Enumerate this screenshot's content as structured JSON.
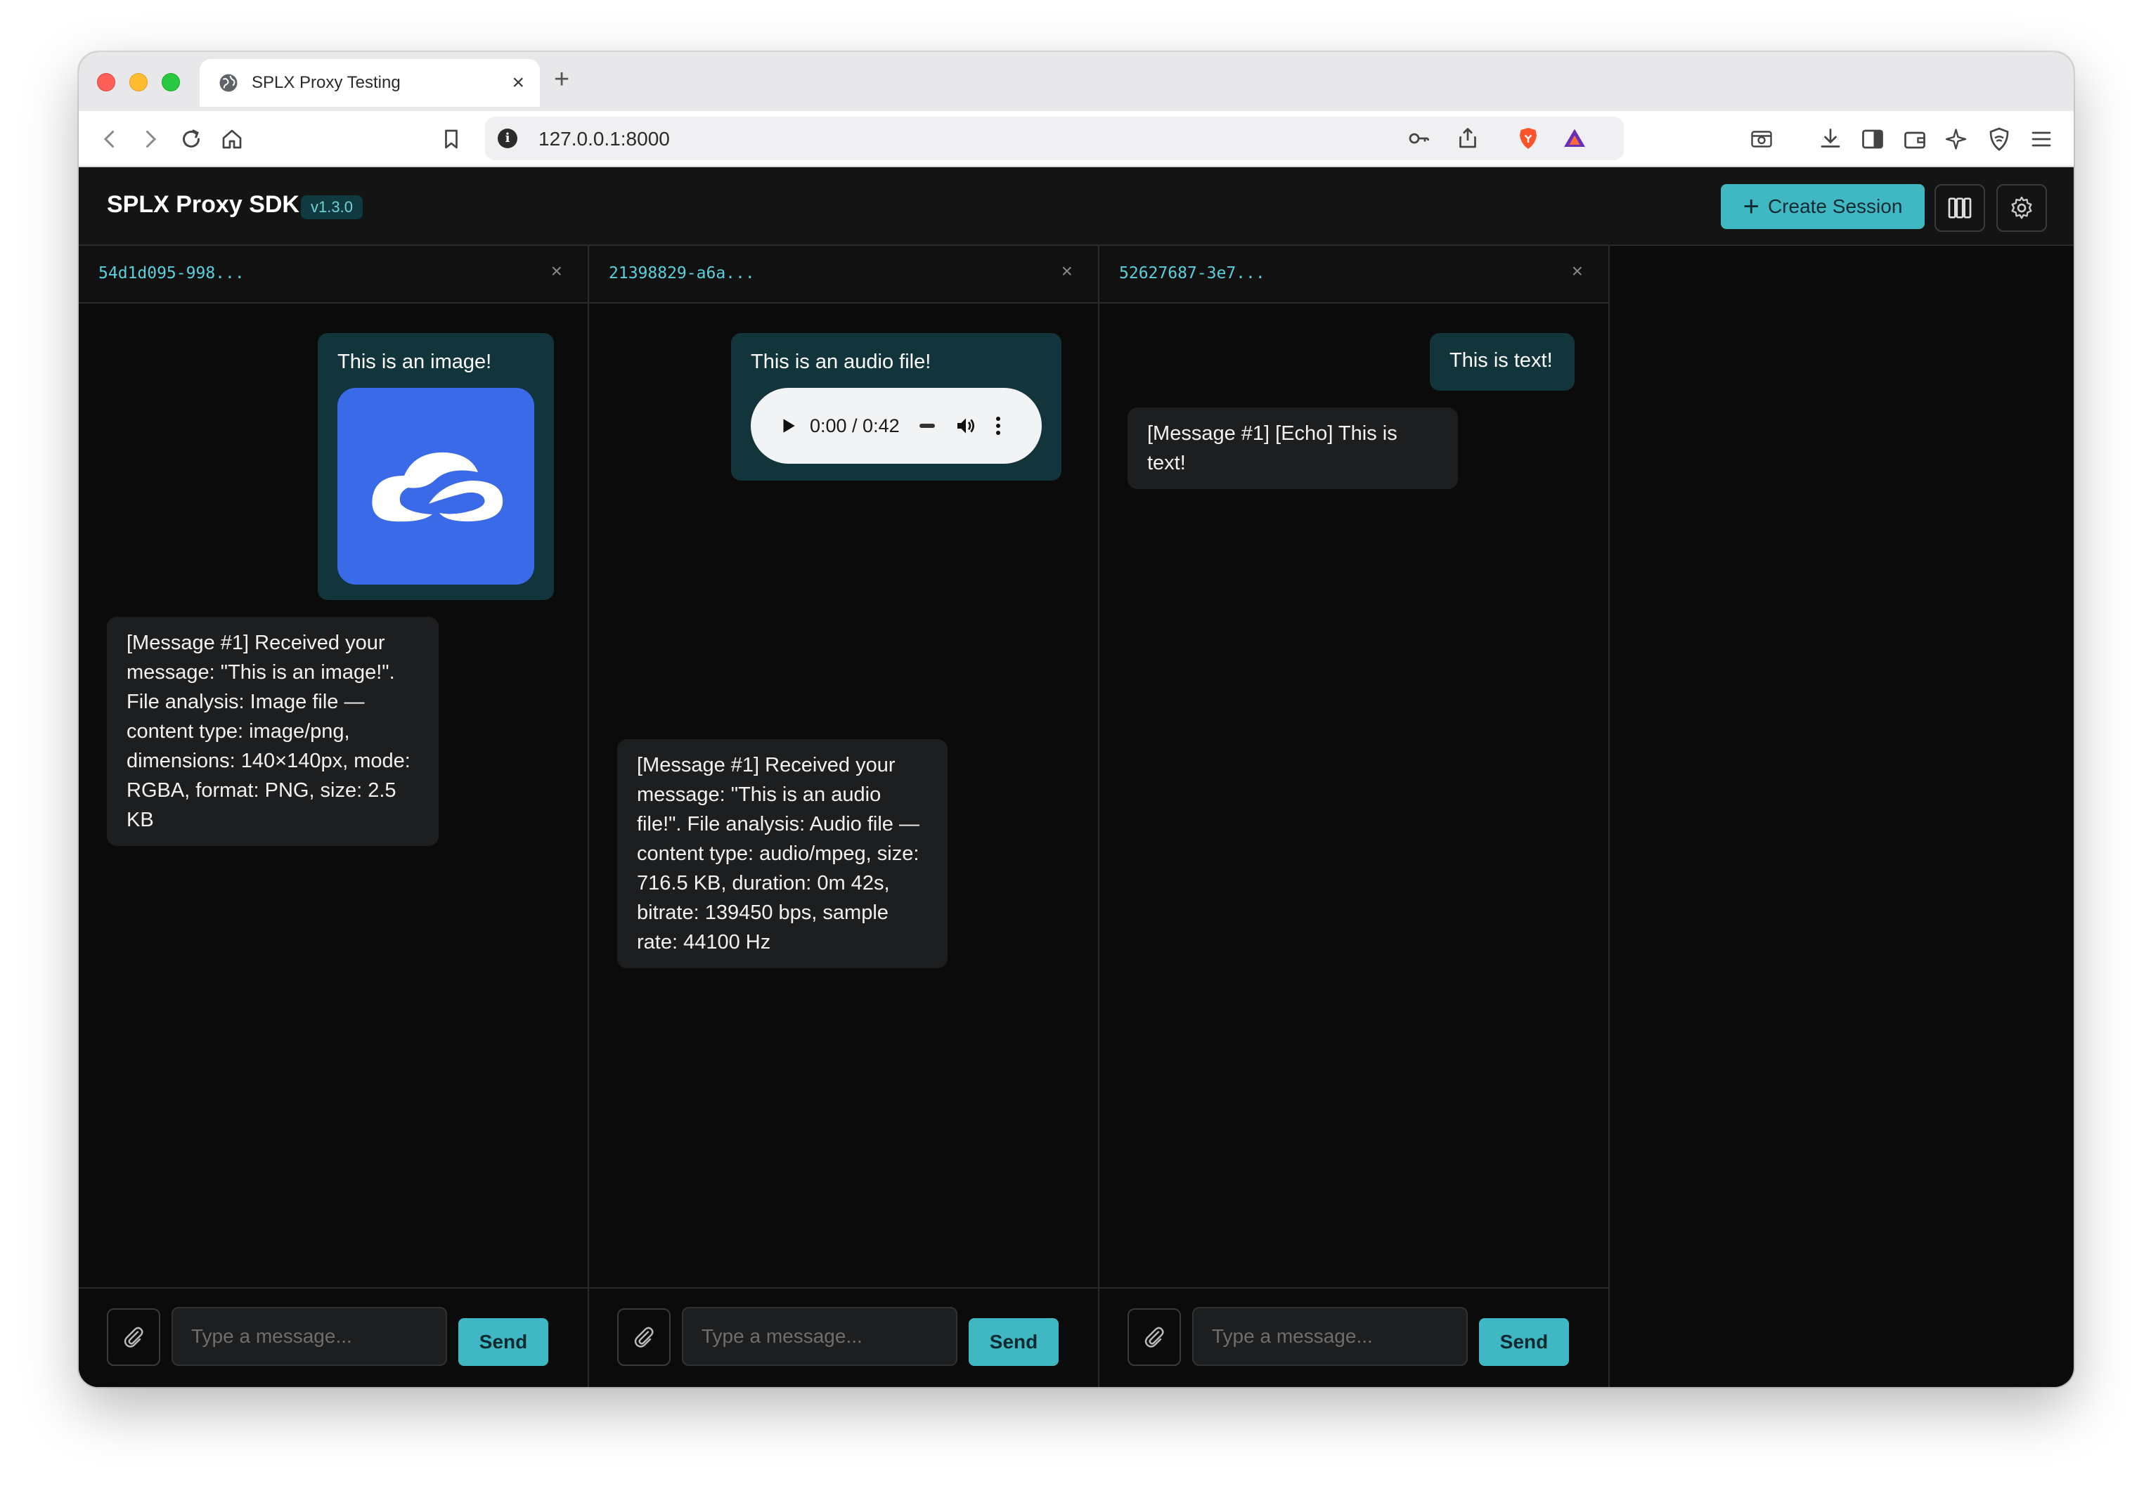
{
  "browser": {
    "tab_title": "SPLX Proxy Testing",
    "tab_close": "×",
    "new_tab": "+",
    "url": "127.0.0.1:8000",
    "url_info_icon": "i"
  },
  "app": {
    "title": "SPLX Proxy SDK",
    "version": "v1.3.0",
    "create_session_label": "Create Session",
    "create_session_plus": "+"
  },
  "panels": [
    {
      "session_id": "54d1d095-998...",
      "close": "×",
      "user_message": "This is an image!",
      "bot_reply": "[Message #1] Received your message: \"This is an image!\". File analysis: Image file — content type: image/png, dimensions: 140×140px, mode: RGBA, format: PNG, size: 2.5 KB",
      "composer": {
        "placeholder": "Type a message...",
        "send_label": "Send"
      }
    },
    {
      "session_id": "21398829-a6a...",
      "close": "×",
      "user_message": "This is an audio file!",
      "audio": {
        "time": "0:00 / 0:42"
      },
      "bot_reply": "[Message #1] Received your message: \"This is an audio file!\". File analysis: Audio file — content type: audio/mpeg, size: 716.5 KB, duration: 0m 42s, bitrate: 139450 bps, sample rate: 44100 Hz",
      "composer": {
        "placeholder": "Type a message...",
        "send_label": "Send"
      }
    },
    {
      "session_id": "52627687-3e7...",
      "close": "×",
      "user_message": "This is text!",
      "bot_reply": "[Message #1] [Echo] This is text!",
      "composer": {
        "placeholder": "Type a message...",
        "send_label": "Send"
      }
    }
  ],
  "colors": {
    "accent": "#40b8c4",
    "session_id": "#5ad0dc",
    "user_bubble": "#12353b",
    "bot_bubble": "#1c1e20",
    "image_thumb": "#3a6ae8"
  },
  "icons": {
    "toolbar": [
      "back-icon",
      "forward-icon",
      "reload-icon",
      "home-icon",
      "bookmark-icon",
      "key-icon",
      "share-icon",
      "brave-shield-icon",
      "brave-rewards-icon",
      "screenshot-icon",
      "download-icon",
      "sidebar-icon",
      "wallet-icon",
      "leo-ai-icon",
      "vpn-icon",
      "menu-icon"
    ],
    "header": [
      "columns-icon",
      "settings-icon"
    ],
    "composer": [
      "paperclip-icon"
    ]
  }
}
